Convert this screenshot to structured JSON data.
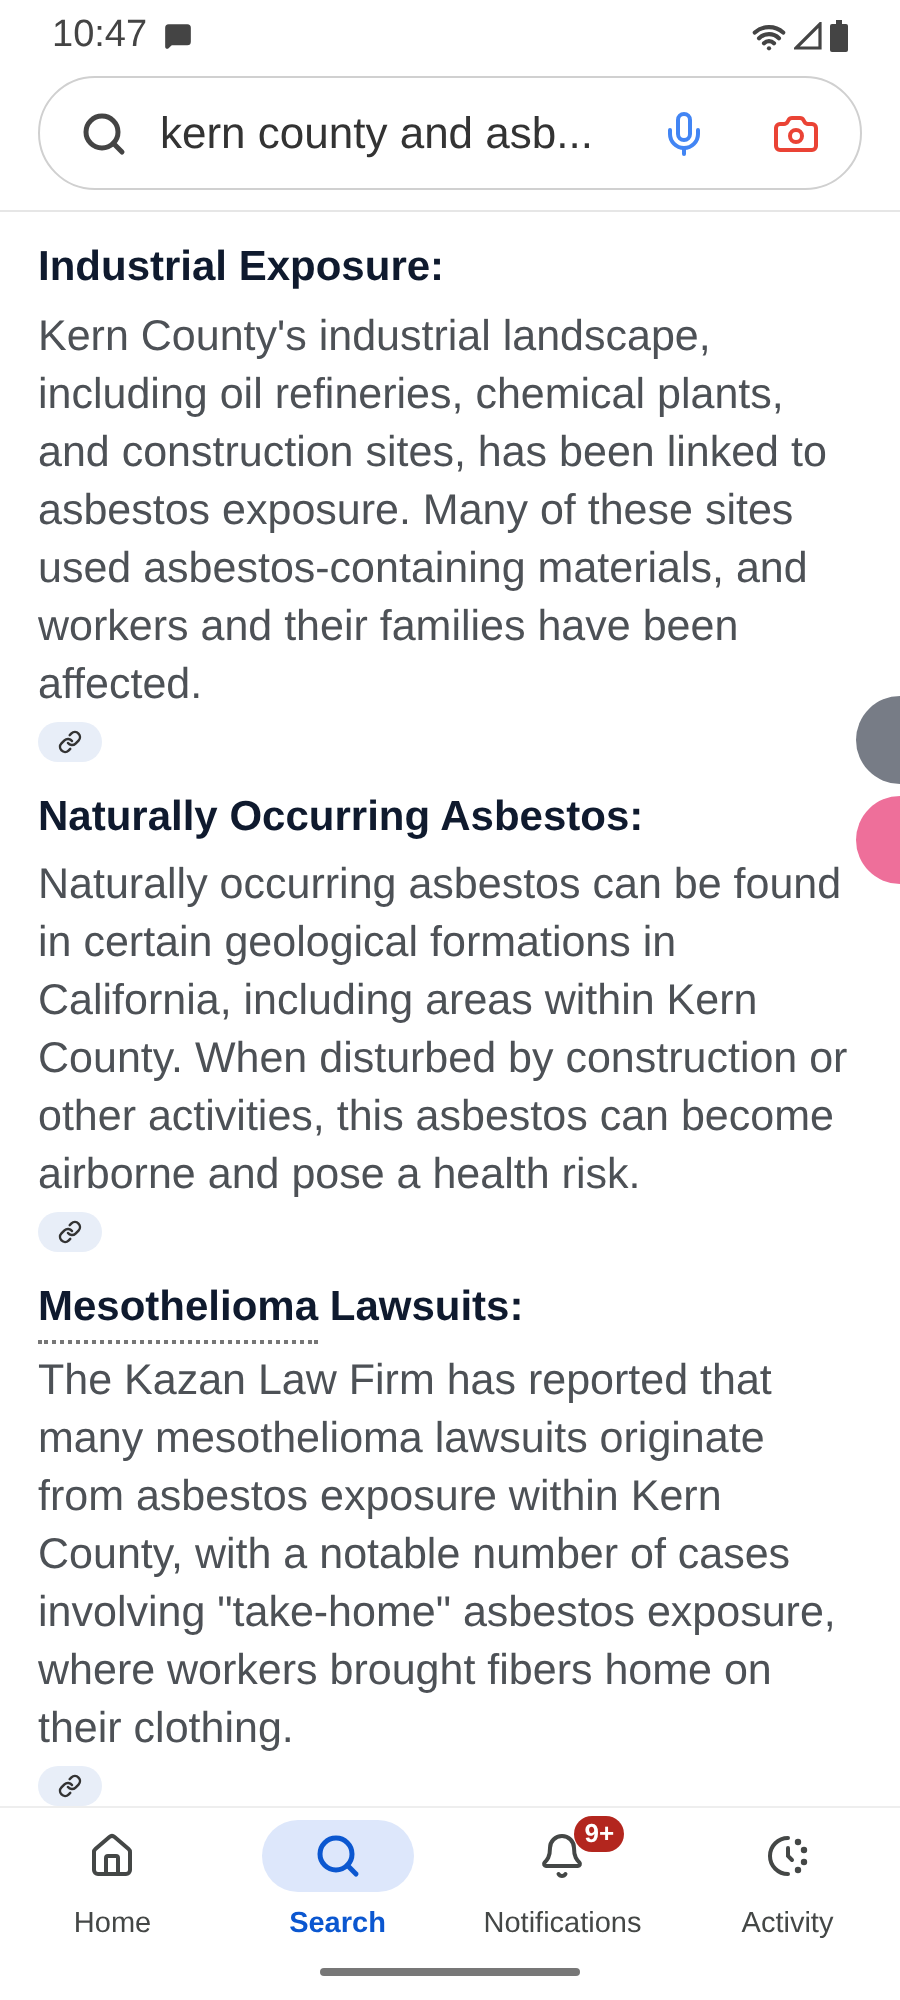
{
  "status_bar": {
    "time": "10:47"
  },
  "search": {
    "value": "kern county and asb..."
  },
  "sections": [
    {
      "heading": "Industrial Exposure:",
      "text": "Kern County's industrial landscape, including oil refineries, chemical plants, and construction sites, has been linked to asbestos exposure. Many of these sites used asbestos-containing materials, and workers and their families have been affected."
    },
    {
      "heading": "Naturally Occurring Asbestos:",
      "text": "Naturally occurring asbestos can be found in certain geological formations in California, including areas within Kern County. When disturbed by construction or other activities, this asbestos can become airborne and pose a health risk."
    },
    {
      "heading_link": "Mesothelioma",
      "heading": " Lawsuits:",
      "text": "The Kazan Law Firm has reported that many mesothelioma lawsuits originate from asbestos exposure within Kern County, with a notable number of cases involving \"take-home\" asbestos exposure, where workers brought fibers home on their clothing."
    }
  ],
  "nav": [
    {
      "kind": "home",
      "label": "Home",
      "selected": false
    },
    {
      "kind": "search",
      "label": "Search",
      "selected": true
    },
    {
      "kind": "bell",
      "label": "Notifications",
      "selected": false,
      "badge": "9+"
    },
    {
      "kind": "activity",
      "label": "Activity",
      "selected": false
    }
  ]
}
